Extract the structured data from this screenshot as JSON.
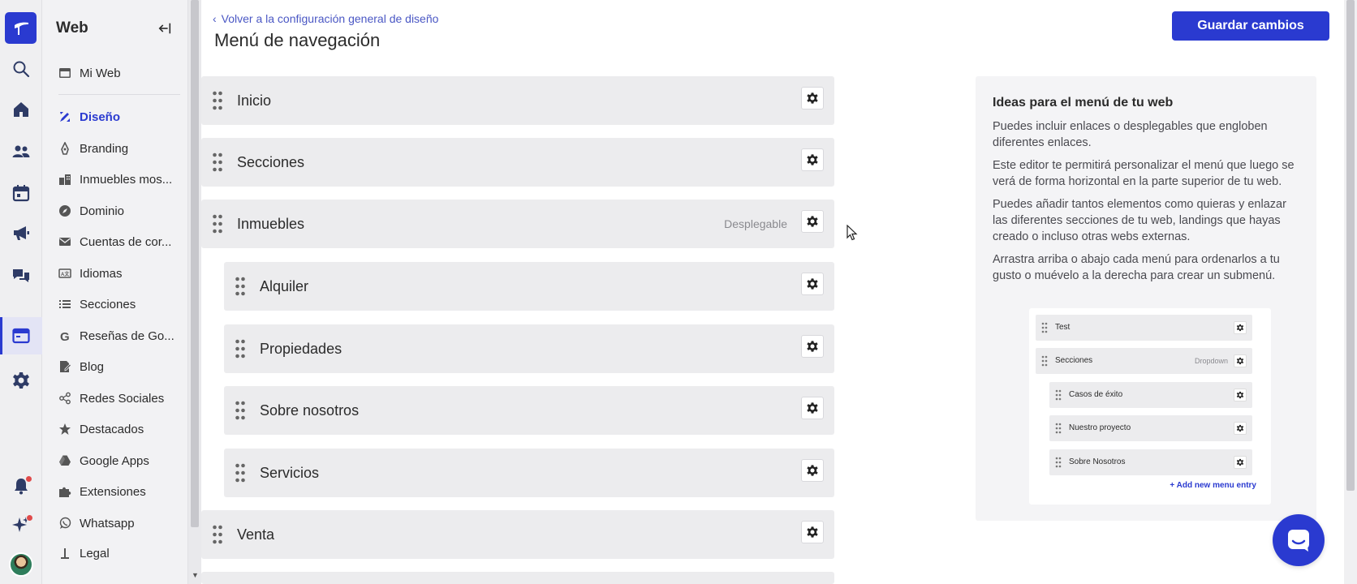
{
  "rail": {
    "items": [
      {
        "icon": "search-icon"
      },
      {
        "icon": "home-icon"
      },
      {
        "icon": "users-icon"
      },
      {
        "icon": "calendar-icon"
      },
      {
        "icon": "megaphone-icon"
      },
      {
        "icon": "chat-icon"
      },
      {
        "icon": "web-icon",
        "active": true
      },
      {
        "icon": "settings-icon"
      },
      {
        "icon": "bell-icon"
      },
      {
        "icon": "sparkle-icon"
      }
    ]
  },
  "sidebar": {
    "title": "Web",
    "items": [
      {
        "label": "Mi Web",
        "icon": "browser-icon"
      },
      {
        "label": "Diseño",
        "icon": "design-icon",
        "active": true
      },
      {
        "label": "Branding",
        "icon": "pen-icon"
      },
      {
        "label": "Inmuebles mos...",
        "icon": "buildings-icon"
      },
      {
        "label": "Dominio",
        "icon": "compass-icon"
      },
      {
        "label": "Cuentas de cor...",
        "icon": "mail-icon"
      },
      {
        "label": "Idiomas",
        "icon": "language-icon"
      },
      {
        "label": "Secciones",
        "icon": "list-icon"
      },
      {
        "label": "Reseñas de Go...",
        "icon": "google-icon"
      },
      {
        "label": "Blog",
        "icon": "blog-icon"
      },
      {
        "label": "Redes Sociales",
        "icon": "share-icon"
      },
      {
        "label": "Destacados",
        "icon": "star-icon"
      },
      {
        "label": "Google Apps",
        "icon": "drive-icon"
      },
      {
        "label": "Extensiones",
        "icon": "puzzle-icon"
      },
      {
        "label": "Whatsapp",
        "icon": "whatsapp-icon"
      },
      {
        "label": "Legal",
        "icon": "legal-icon"
      }
    ]
  },
  "header": {
    "back_link": "Volver a la configuración general de diseño",
    "title": "Menú de navegación",
    "save_label": "Guardar cambios"
  },
  "menu": [
    {
      "label": "Inicio",
      "level": 0,
      "tag": ""
    },
    {
      "label": "Secciones",
      "level": 0,
      "tag": ""
    },
    {
      "label": "Inmuebles",
      "level": 0,
      "tag": "Desplegable"
    },
    {
      "label": "Alquiler",
      "level": 1,
      "tag": ""
    },
    {
      "label": "Propiedades",
      "level": 1,
      "tag": ""
    },
    {
      "label": "Sobre nosotros",
      "level": 1,
      "tag": ""
    },
    {
      "label": "Servicios",
      "level": 1,
      "tag": ""
    },
    {
      "label": "Venta",
      "level": 0,
      "tag": ""
    }
  ],
  "tips": {
    "title": "Ideas para el menú de tu web",
    "p1": "Puedes incluir enlaces o desplegables que engloben diferentes enlaces.",
    "p2": "Este editor te permitirá personalizar el menú que luego se verá de forma horizontal en la parte superior de tu web.",
    "p3": "Puedes añadir tantos elementos como quieras y enlazar las diferentes secciones de tu web, landings que hayas creado o incluso otras webs externas.",
    "p4": "Arrastra arriba o abajo cada menú para ordenarlos a tu gusto o muévelo a la derecha para crear un submenú.",
    "example": {
      "rows": [
        {
          "label": "Test",
          "tag": ""
        },
        {
          "label": "Secciones",
          "tag": "Dropdown"
        },
        {
          "label": "Casos de éxito",
          "tag": ""
        },
        {
          "label": "Nuestro proyecto",
          "tag": ""
        },
        {
          "label": "Sobre Nosotros",
          "tag": ""
        }
      ],
      "add_label": "+ Add new menu entry"
    }
  },
  "colors": {
    "accent": "#2a3ad0",
    "row_bg": "#ececee"
  }
}
